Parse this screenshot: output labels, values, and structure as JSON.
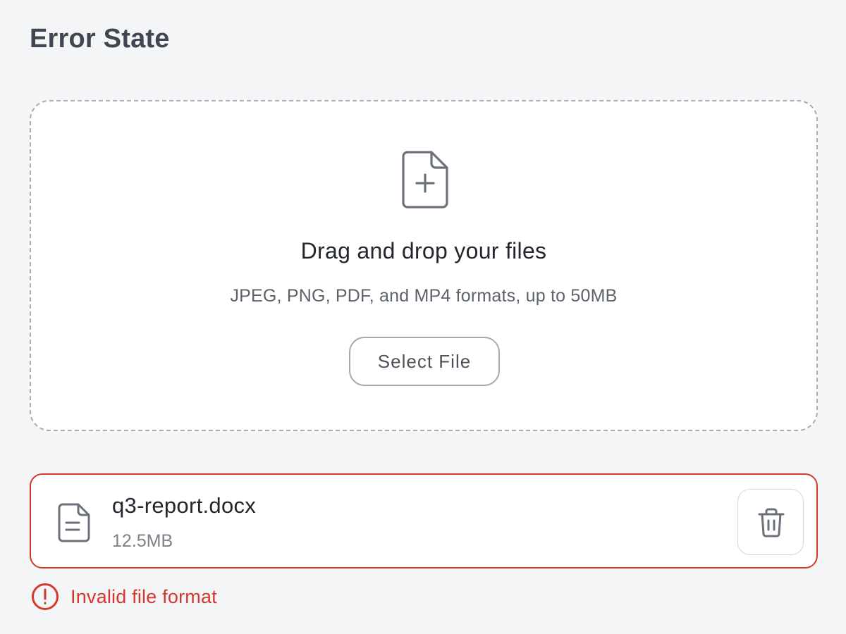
{
  "section_title": "Error State",
  "dropzone": {
    "icon": "file-plus-icon",
    "heading": "Drag and drop your files",
    "subtext": "JPEG, PNG, PDF, and MP4 formats, up to 50MB",
    "select_button_label": "Select File"
  },
  "file": {
    "icon": "file-text-icon",
    "name": "q3-report.docx",
    "size": "12.5MB",
    "delete_icon": "trash-icon"
  },
  "error": {
    "icon": "alert-circle-icon",
    "message": "Invalid file format"
  },
  "colors": {
    "background": "#f4f5f7",
    "error": "#d7382c",
    "border_dashed": "#a9adb3",
    "text_primary": "#22262d",
    "text_secondary": "#5d636d"
  }
}
